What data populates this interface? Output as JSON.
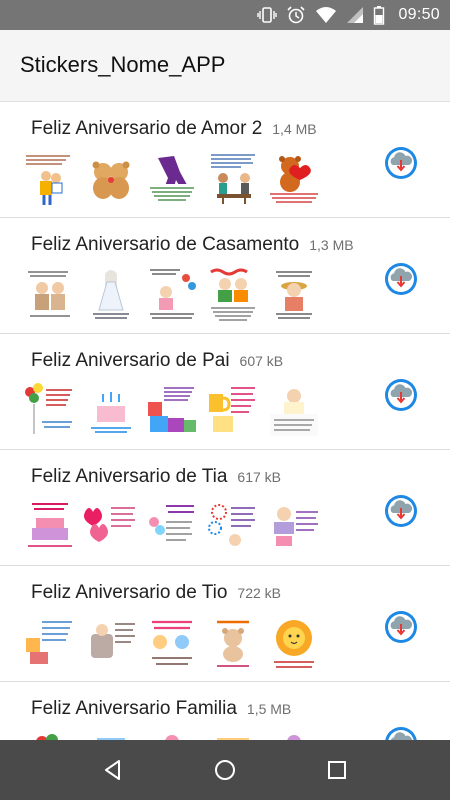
{
  "status_bar": {
    "time": "09:50",
    "icons": [
      "vibrate-icon",
      "alarm-icon",
      "wifi-icon",
      "signal-icon",
      "battery-icon"
    ]
  },
  "app_bar": {
    "title": "Stickers_Nome_APP"
  },
  "packs": [
    {
      "name": "Feliz Aniversario de Amor 2",
      "size": "1,4 MB"
    },
    {
      "name": "Feliz Aniversario de Casamento",
      "size": "1,3 MB"
    },
    {
      "name": "Feliz Aniversario de Pai",
      "size": "607 kB"
    },
    {
      "name": "Feliz Aniversario de Tia",
      "size": "617 kB"
    },
    {
      "name": "Feliz Aniversario de Tio",
      "size": "722 kB"
    },
    {
      "name": "Feliz Aniversario Familia",
      "size": "1,5 MB"
    }
  ],
  "nav_bar": {
    "buttons": [
      "back-icon",
      "home-icon",
      "recents-icon"
    ]
  },
  "colors": {
    "status_bar": "#757575",
    "app_bar": "#f5f5f5",
    "nav_bar": "#4a4a4a",
    "download_accent": "#1e88e5"
  }
}
